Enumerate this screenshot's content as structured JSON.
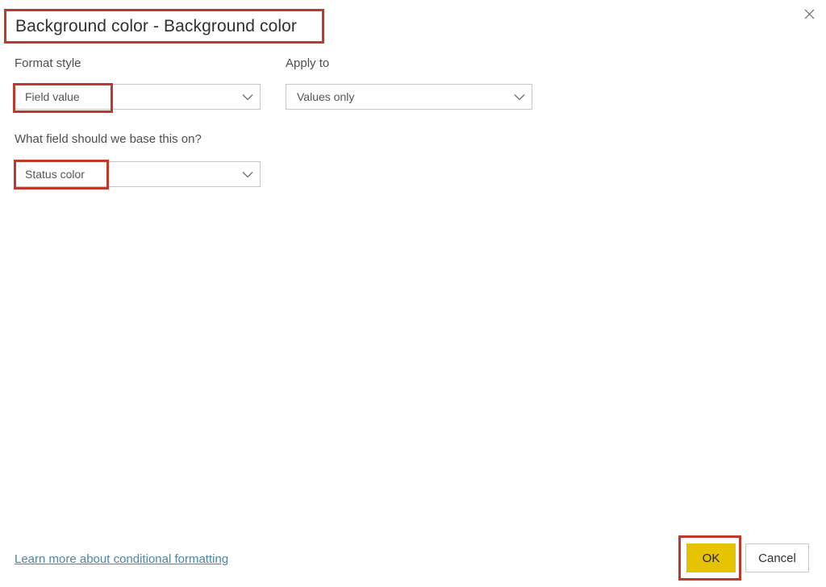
{
  "dialog": {
    "title": "Background color - Background color",
    "close_icon": "close-icon"
  },
  "fields": {
    "format_style": {
      "label": "Format style",
      "value": "Field value",
      "chevron_icon": "chevron-down-icon"
    },
    "apply_to": {
      "label": "Apply to",
      "value": "Values only",
      "chevron_icon": "chevron-down-icon"
    },
    "base_field": {
      "label": "What field should we base this on?",
      "value": "Status color",
      "chevron_icon": "chevron-down-icon"
    }
  },
  "footer": {
    "link_text": "Learn more about conditional formatting",
    "ok_label": "OK",
    "cancel_label": "Cancel"
  },
  "colors": {
    "annotation_red": "#c0392b",
    "ok_button": "#e6c300",
    "link": "#4a86a8",
    "title_text": "#323130",
    "border": "#c8c6c4"
  }
}
